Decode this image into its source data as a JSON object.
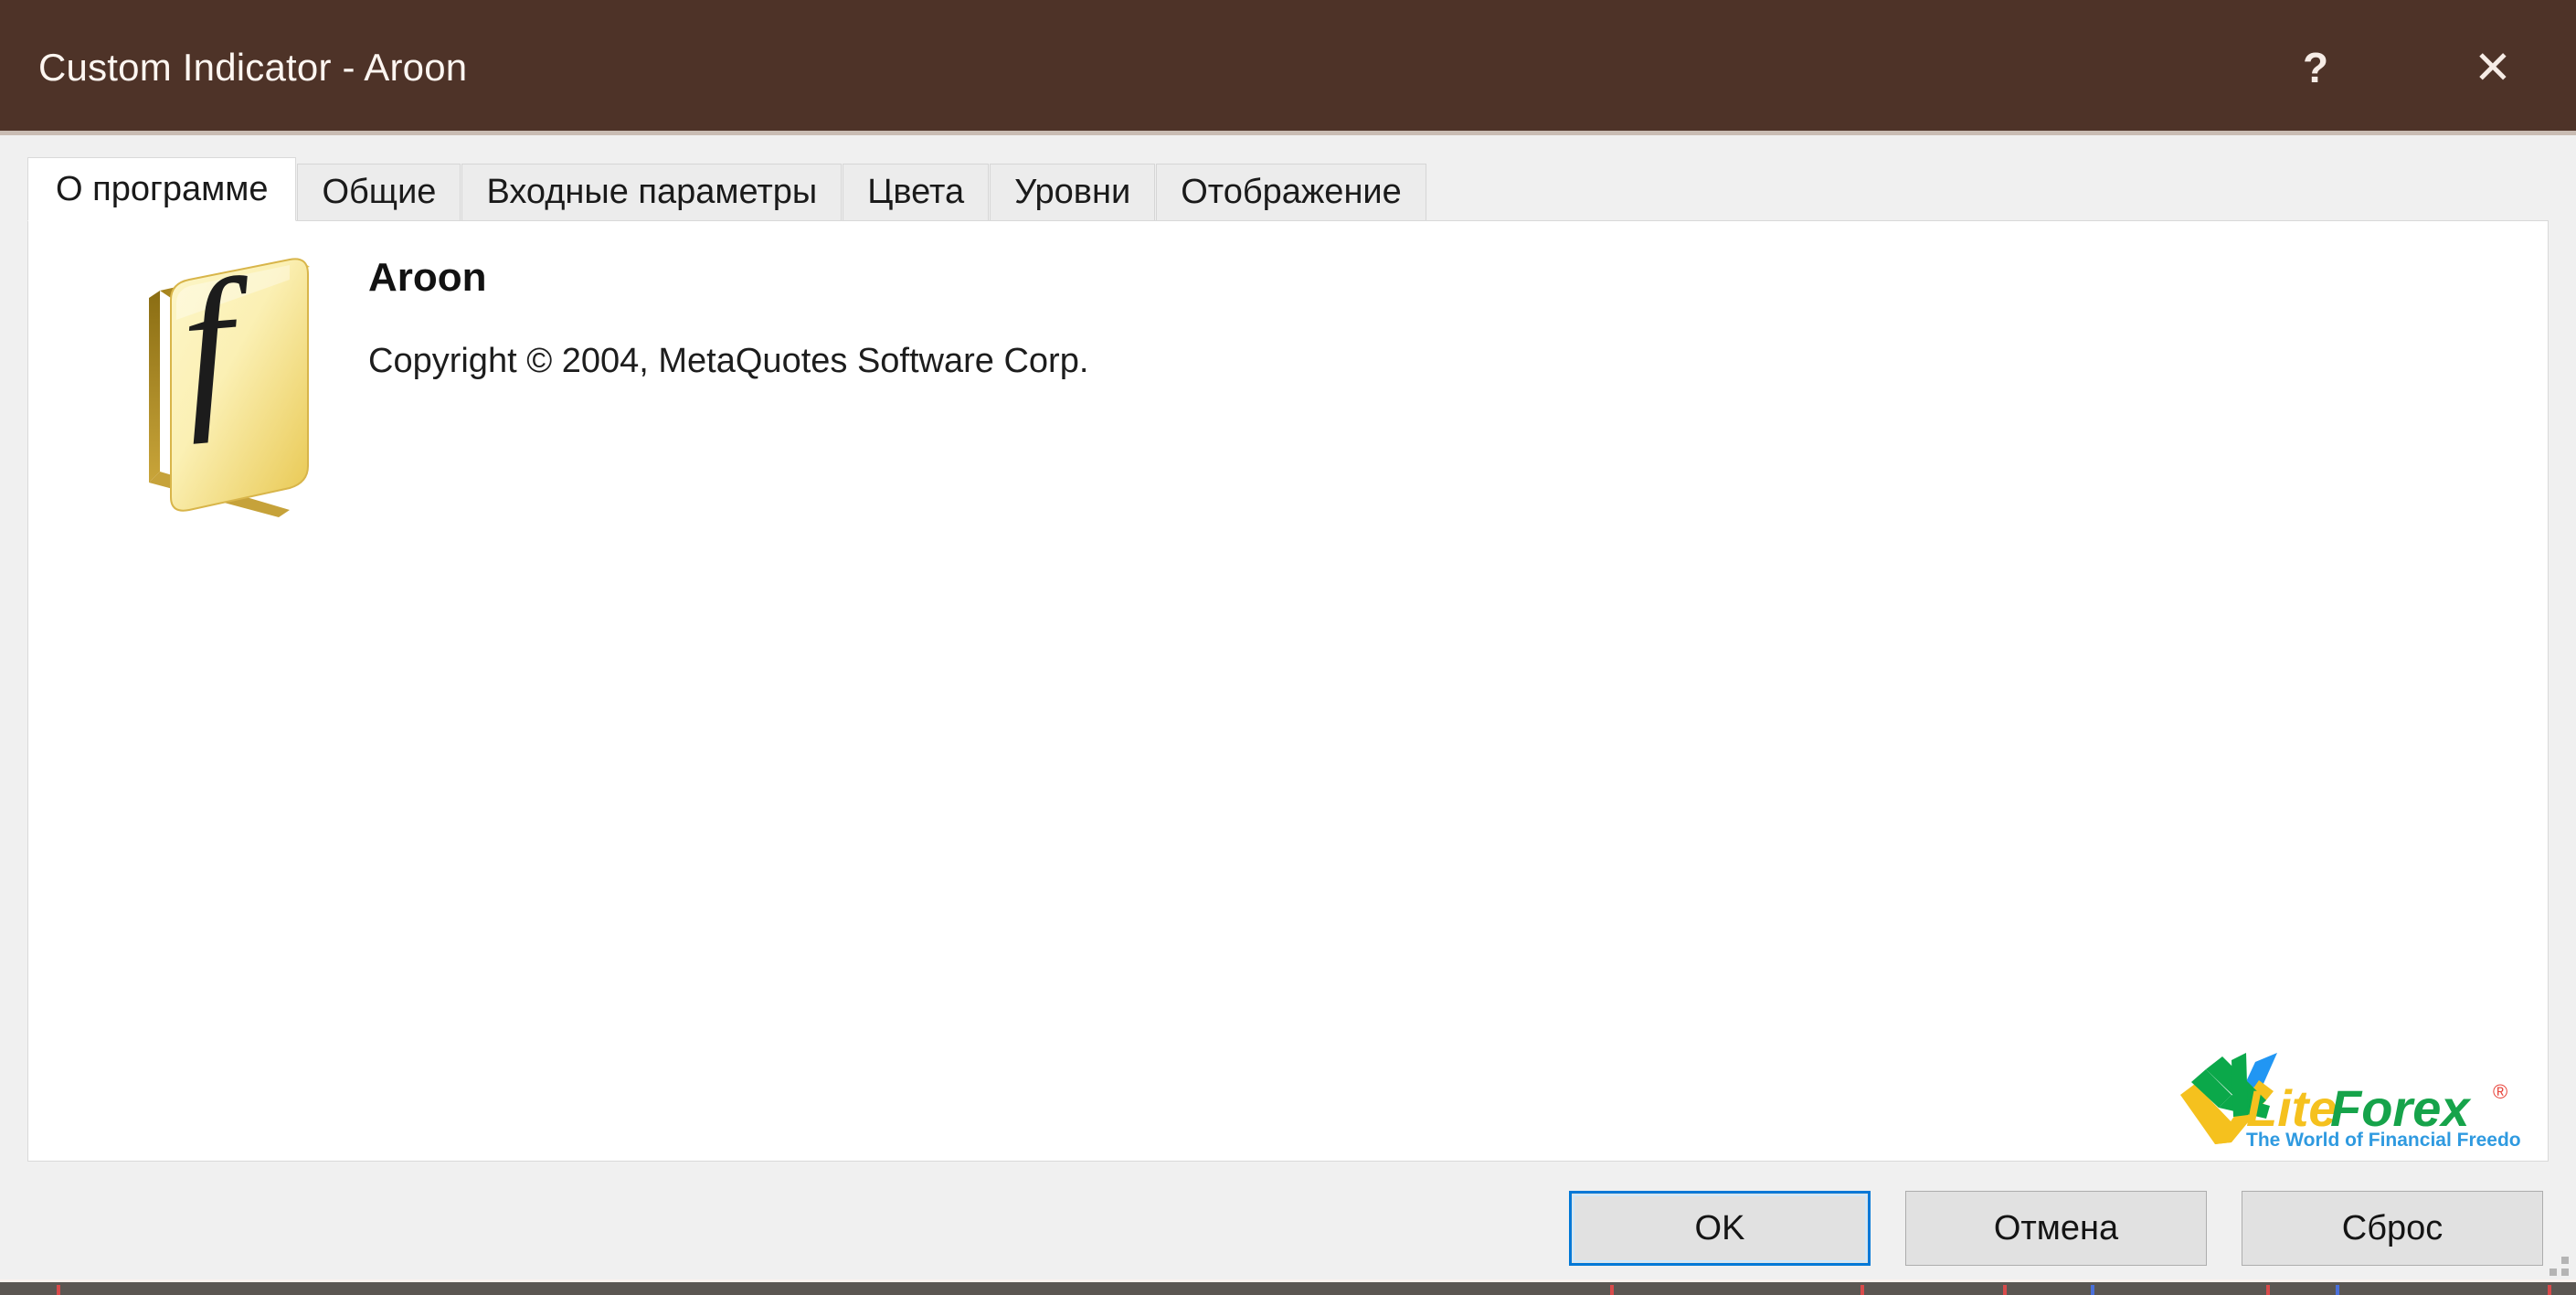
{
  "window": {
    "title": "Custom Indicator - Aroon",
    "titlebar_color": "#4e3328",
    "background_color": "#f0f0f0",
    "help_button": "?",
    "close_button": "✕"
  },
  "tabs": [
    {
      "label": "О программе",
      "active": true
    },
    {
      "label": "Общие",
      "active": false
    },
    {
      "label": "Входные параметры",
      "active": false
    },
    {
      "label": "Цвета",
      "active": false
    },
    {
      "label": "Уровни",
      "active": false
    },
    {
      "label": "Отображение",
      "active": false
    }
  ],
  "about": {
    "icon_name": "function-fx-icon",
    "title": "Aroon",
    "copyright": "Copyright © 2004, MetaQuotes Software Corp."
  },
  "logo": {
    "name": "liteforex-logo",
    "word_lite": "Lite",
    "word_forex": "Forex",
    "registered_mark": "®",
    "tagline": "The World of Financial Freedom",
    "color_lite": "#f5c11e",
    "color_forex": "#16a34a",
    "color_tagline": "#2f9ae0",
    "color_mark_green": "#0ba84a",
    "color_mark_yellow": "#f5c11e",
    "color_mark_blue": "#2196f3",
    "color_registered": "#e8433a"
  },
  "footer": {
    "ok_label": "OK",
    "cancel_label": "Отмена",
    "reset_label": "Сброс",
    "accent_color": "#0078d7"
  }
}
